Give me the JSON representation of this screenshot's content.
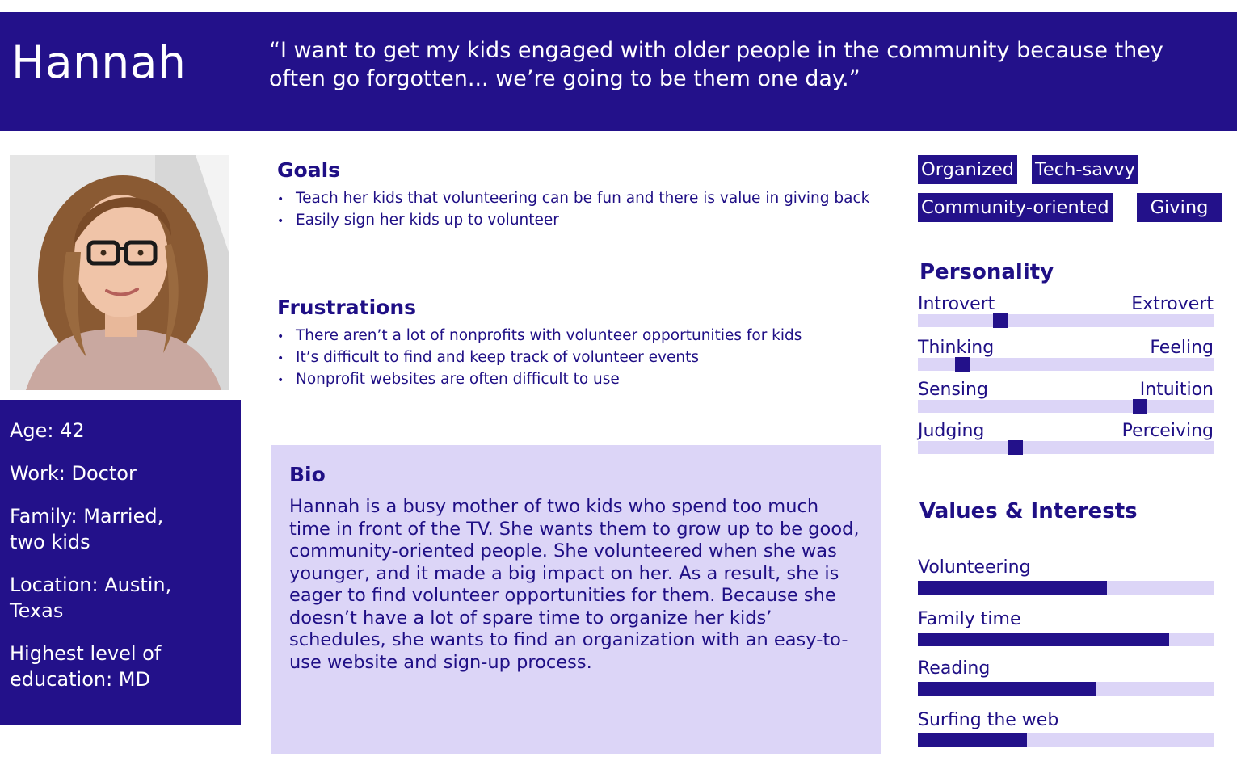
{
  "persona": {
    "name": "Hannah",
    "quote": "“I want to get my kids engaged with older people in the community because they often go forgotten... we’re going to be them one day.”"
  },
  "demographics": [
    {
      "lines": [
        "Age: 42"
      ]
    },
    {
      "lines": [
        "Work: Doctor"
      ]
    },
    {
      "lines": [
        "Family: Married,",
        "two kids"
      ]
    },
    {
      "lines": [
        "Location: Austin,",
        "Texas"
      ]
    },
    {
      "lines": [
        "Highest level of",
        "education: MD"
      ]
    }
  ],
  "goals": {
    "title": "Goals",
    "items": [
      "Teach her kids that volunteering can be fun and there is value in giving back",
      "Easily sign her kids up to volunteer"
    ]
  },
  "frustrations": {
    "title": "Frustrations",
    "items": [
      "There aren’t a lot of nonprofits with volunteer opportunities for kids",
      "It’s difficult to find and keep track of volunteer events",
      "Nonprofit websites are often difficult to use"
    ]
  },
  "bio": {
    "title": "Bio",
    "text": "Hannah is a busy mother of two kids who spend too much time in front of the TV. She wants them to grow up to be good, community-oriented people. She volunteered when she was younger, and it made a big impact on her. As a result, she is eager to find volunteer opportunities for them. Because she doesn’t have a lot of spare time to organize her kids’ schedules, she wants to find an organization with an easy-to-use website and sign-up process."
  },
  "tags": [
    "Organized",
    "Tech-savvy",
    "Community-oriented",
    "Giving"
  ],
  "personality": {
    "title": "Personality",
    "traits": [
      {
        "left": "Introvert",
        "right": "Extrovert",
        "position": 0.28
      },
      {
        "left": "Thinking",
        "right": "Feeling",
        "position": 0.15
      },
      {
        "left": "Sensing",
        "right": "Intuition",
        "position": 0.75
      },
      {
        "left": "Judging",
        "right": "Perceiving",
        "position": 0.33
      }
    ]
  },
  "values": {
    "title": "Values & Interests",
    "items": [
      {
        "label": "Volunteering",
        "level": 0.64
      },
      {
        "label": "Family time",
        "level": 0.85
      },
      {
        "label": "Reading",
        "level": 0.6
      },
      {
        "label": "Surfing the web",
        "level": 0.37
      }
    ]
  },
  "colors": {
    "navy": "#23118a",
    "lavender": "#dcd5f7",
    "text": "#1f0f85"
  }
}
